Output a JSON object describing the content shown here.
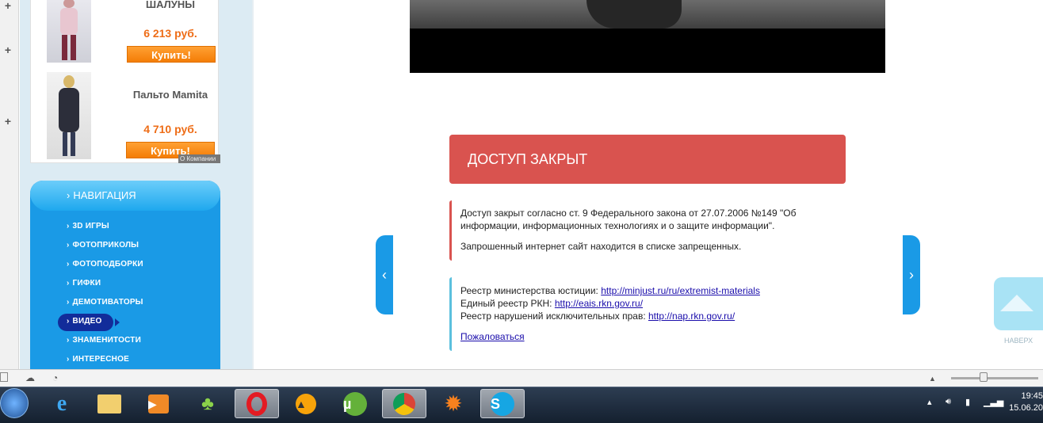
{
  "sidebar_products": [
    {
      "name": "ШАЛУНЫ",
      "price": "6 213 руб.",
      "buy": "Купить!"
    },
    {
      "name": "Пальто Mamita",
      "price": "4 710 руб.",
      "buy": "Купить!"
    }
  ],
  "about_tag": "О Компании",
  "nav": {
    "title": "НАВИГАЦИЯ",
    "arrow": "›",
    "items": [
      "3D ИГРЫ",
      "ФОТОПРИКОЛЫ",
      "ФОТОПОДБОРКИ",
      "ГИФКИ",
      "ДЕМОТИВАТОРЫ",
      "ВИДЕО",
      "ЗНАМЕНИТОСТИ",
      "ИНТЕРЕСНОЕ"
    ],
    "active_index": 5
  },
  "blocked": {
    "title": "ДОСТУП ЗАКРЫТ",
    "law_text": "Доступ закрыт согласно ст. 9 Федерального закона от 27.07.2006 №149 \"Об информации, информационных технологиях и о защите информации\".",
    "site_text": "Запрошенный интернет сайт находится в списке запрещенных.",
    "registries": [
      {
        "label": "Реестр министерства юстиции:",
        "link": "http://minjust.ru/ru/extremist-materials"
      },
      {
        "label": "Единый реестр РКН:",
        "link": "http://eais.rkn.gov.ru/"
      },
      {
        "label": "Реестр нарушений исключительных прав:",
        "link": "http://nap.rkn.gov.ru/"
      }
    ],
    "complain": "Пожаловаться"
  },
  "slider": {
    "prev": "‹",
    "next": "›"
  },
  "up_button": {
    "label": "НАВЕРХ"
  },
  "gutter": {
    "plus": "+"
  },
  "taskbar": {
    "apps": [
      "internet-explorer",
      "file-explorer",
      "media-player",
      "games",
      "opera",
      "aimp",
      "utorrent",
      "chrome",
      "avast",
      "skype"
    ],
    "active_app": "opera",
    "time": "19:45",
    "date": "15.06.20"
  },
  "colors": {
    "accent": "#1a9ae6",
    "danger": "#d9534f",
    "info": "#5bc0de",
    "price": "#ee6d17",
    "buy": "#f47d06"
  }
}
